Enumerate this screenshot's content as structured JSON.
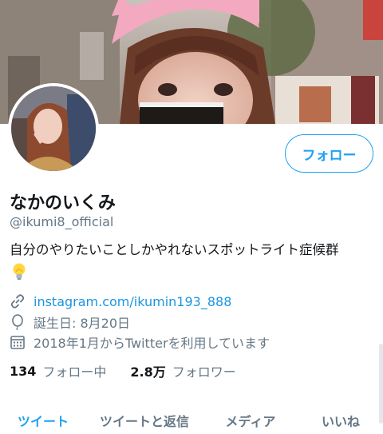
{
  "profile": {
    "display_name": "なかのいくみ",
    "handle": "@ikumi8_official",
    "bio": "自分のやりたいことしかやれないスポットライト症候群",
    "bio_emoji": "lightbulb-icon",
    "link": "instagram.com/ikumin193_888",
    "birthday": "誕生日: 8月20日",
    "joined": "2018年1月からTwitterを利用しています"
  },
  "actions": {
    "follow_label": "フォロー"
  },
  "stats": {
    "following_count": "134",
    "following_label": "フォロー中",
    "followers_count": "2.8万",
    "followers_label": "フォロワー"
  },
  "tabs": [
    {
      "label": "ツイート",
      "active": true
    },
    {
      "label": "ツイートと返信",
      "active": false
    },
    {
      "label": "メディア",
      "active": false
    },
    {
      "label": "いいね",
      "active": false
    }
  ],
  "icons": {
    "link": "link-icon",
    "birthday": "balloon-icon",
    "joined": "calendar-icon"
  },
  "colors": {
    "accent": "#1da1f2",
    "link": "#1b95e0",
    "secondary_text": "#657786",
    "primary_text": "#14171a"
  }
}
